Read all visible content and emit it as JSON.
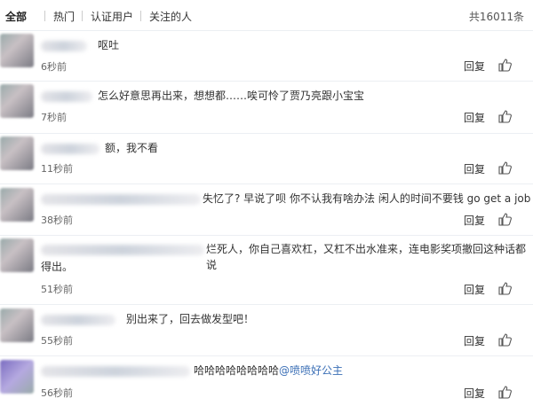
{
  "tabs": [
    "全部",
    "热门",
    "认证用户",
    "关注的人"
  ],
  "total_label": "共16011条",
  "colors": {
    "mention": "#3b6fb6",
    "divider": "#eceff3"
  },
  "comments": [
    {
      "text": "呕吐",
      "time": "6秒前",
      "reply": "回复"
    },
    {
      "text": "怎么好意思再出来，想想都……唉可怜了贾乃亮跟小宝宝",
      "time": "7秒前",
      "reply": "回复"
    },
    {
      "text": "额，我不看",
      "time": "11秒前",
      "reply": "回复"
    },
    {
      "text": "失忆了? 早说了呗 你不认我有啥办法 闲人的时间不要钱 go get a job",
      "time": "38秒前",
      "reply": "回复"
    },
    {
      "text": "烂死人，你自己喜欢杠，又杠不出水准来，连电影奖项撤回这种话都说",
      "text2": "得出。",
      "time": "51秒前",
      "reply": "回复"
    },
    {
      "text": "别出来了，回去做发型吧！",
      "time": "55秒前",
      "reply": "回复"
    },
    {
      "text": "哈哈哈哈哈哈哈哈",
      "mention": "@喷喷好公主",
      "time": "56秒前",
      "reply": "回复"
    }
  ]
}
